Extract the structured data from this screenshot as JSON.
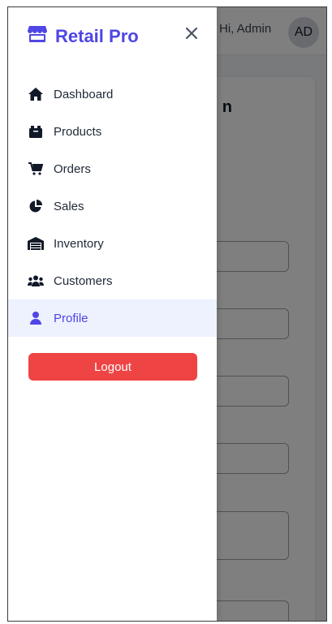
{
  "header": {
    "greeting": "Hi, Admin",
    "avatar_initials": "AD"
  },
  "main": {
    "title_fragment": "n"
  },
  "drawer": {
    "brand": "Retail Pro",
    "brand_icon": "store-icon",
    "close_icon": "close-icon",
    "items": [
      {
        "label": "Dashboard",
        "icon": "home-icon",
        "active": false
      },
      {
        "label": "Products",
        "icon": "box-icon",
        "active": false
      },
      {
        "label": "Orders",
        "icon": "cart-icon",
        "active": false
      },
      {
        "label": "Sales",
        "icon": "pie-chart-icon",
        "active": false
      },
      {
        "label": "Inventory",
        "icon": "warehouse-icon",
        "active": false
      },
      {
        "label": "Customers",
        "icon": "users-icon",
        "active": false
      },
      {
        "label": "Profile",
        "icon": "user-icon",
        "active": true
      }
    ],
    "logout_label": "Logout"
  },
  "colors": {
    "accent": "#4f46e5",
    "active_bg": "#eef2ff",
    "logout": "#ef4444",
    "overlay": "rgba(0,0,0,0.5)"
  }
}
